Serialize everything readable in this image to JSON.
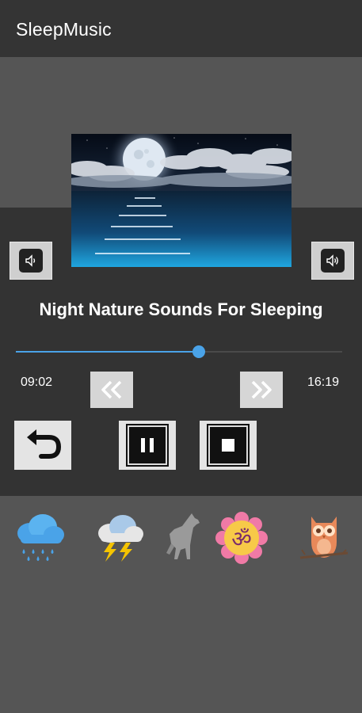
{
  "app": {
    "title": "SleepMusic"
  },
  "player": {
    "track_title": "Night Nature Sounds For Sleeping",
    "elapsed": "09:02",
    "duration": "16:19",
    "progress_fraction": 0.56
  },
  "icons": {
    "volume_down": "speaker-low-icon",
    "volume_up": "speaker-high-icon",
    "rewind": "rewind-icon",
    "fast_forward": "fast-forward-icon",
    "repeat": "repeat-back-icon",
    "pause": "pause-icon",
    "stop": "stop-icon"
  },
  "sounds": [
    {
      "name": "rain-cloud-icon"
    },
    {
      "name": "thunderstorm-icon"
    },
    {
      "name": "wolf-icon"
    },
    {
      "name": "om-icon"
    },
    {
      "name": "owl-icon"
    }
  ],
  "colors": {
    "accent": "#4aa3e8",
    "appbar": "#343434",
    "player_bg": "#333333",
    "page_bg": "#555555"
  }
}
